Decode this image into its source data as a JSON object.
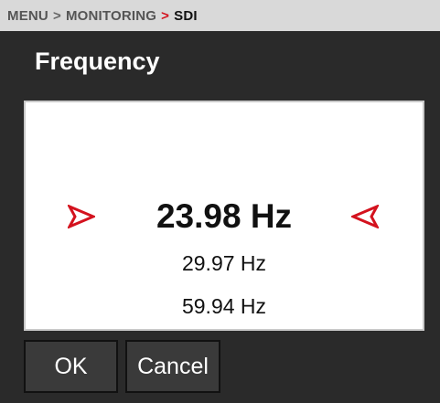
{
  "breadcrumb": {
    "items": [
      "MENU",
      "MONITORING",
      "SDI"
    ],
    "separator": ">",
    "accent_color": "#d4121e"
  },
  "title": "Frequency",
  "picker": {
    "selected": "23.98 Hz",
    "options_below": [
      "29.97 Hz",
      "59.94 Hz"
    ],
    "left_icon": "chevron-right-red-icon",
    "right_icon": "chevron-left-red-icon"
  },
  "buttons": {
    "ok": "OK",
    "cancel": "Cancel"
  }
}
